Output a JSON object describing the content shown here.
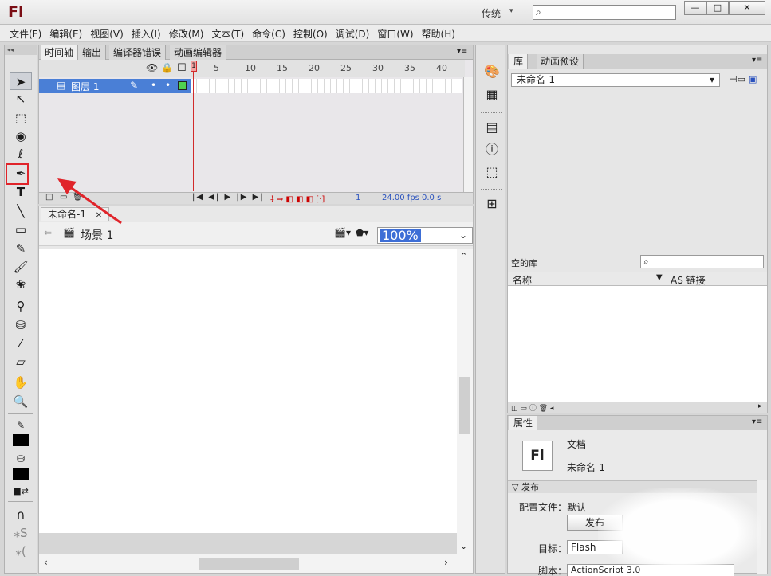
{
  "app": {
    "logo": "Fl",
    "workspace": "传统"
  },
  "menu": [
    "文件(F)",
    "编辑(E)",
    "视图(V)",
    "插入(I)",
    "修改(M)",
    "文本(T)",
    "命令(C)",
    "控制(O)",
    "调试(D)",
    "窗口(W)",
    "帮助(H)"
  ],
  "timeline": {
    "tabs": [
      "时间轴",
      "输出",
      "编译器错误",
      "动画编辑器"
    ],
    "layer_name": "图层 1",
    "frame_numbers": [
      "1",
      "5",
      "10",
      "15",
      "20",
      "25",
      "30",
      "35",
      "40"
    ],
    "fps": "24.00 fps",
    "time": "0.0 s",
    "current_frame": "1"
  },
  "stage": {
    "doc_tab": "未命名-1",
    "scene": "场景 1",
    "zoom": "100%"
  },
  "library": {
    "tabs": [
      "库",
      "动画预设"
    ],
    "document": "未命名-1",
    "empty_label": "空的库",
    "col_name": "名称",
    "col_linkage": "AS 链接"
  },
  "properties": {
    "tab": "属性",
    "icon_text": "Fl",
    "doc_type": "文档",
    "doc_name": "未命名-1",
    "section": "发布",
    "profile": "配置文件：默认",
    "publish_button": "发布",
    "target_label": "目标：",
    "target_value": "Flash",
    "script_label": "脚本：",
    "script_value": "ActionScript 3.0"
  },
  "colors": {
    "annotation": "#e0242a",
    "selection": "#3d6ed6",
    "brand": "#7a0d14"
  }
}
